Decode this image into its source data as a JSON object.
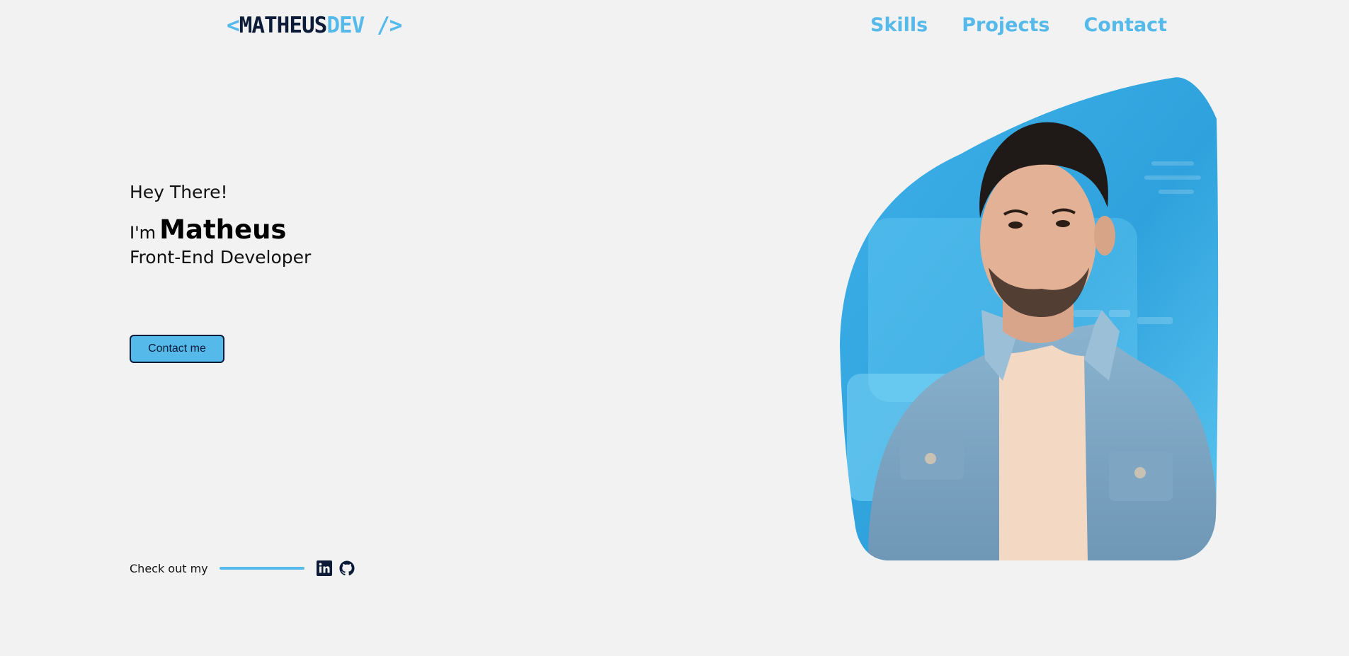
{
  "header": {
    "logo": {
      "open": "<",
      "first": "MATHEUS",
      "second": "DEV",
      "close": " />"
    },
    "nav": [
      {
        "label": "Skills"
      },
      {
        "label": "Projects"
      },
      {
        "label": "Contact"
      }
    ]
  },
  "hero": {
    "greeting": "Hey There!",
    "im": "I'm",
    "name": "Matheus",
    "role": "Front-End Developer",
    "cta": "Contact me"
  },
  "social": {
    "label": "Check out my",
    "icons": [
      "linkedin-icon",
      "github-icon"
    ]
  },
  "colors": {
    "accent": "#55b9ea",
    "navy": "#0b1b38",
    "background": "#f2f2f2"
  }
}
